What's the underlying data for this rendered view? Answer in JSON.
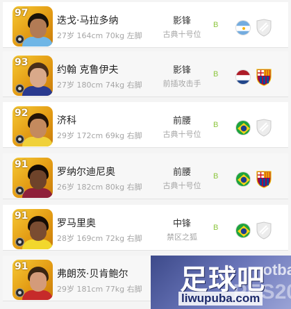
{
  "players": [
    {
      "rating": "97",
      "name": "迭戈·马拉多纳",
      "meta": "27岁 164cm 70kg 左脚",
      "position": "影锋",
      "role": "古典十号位",
      "grade": "B",
      "nation": "argentina-flag-icon",
      "club": "generic-club-shield-icon",
      "colors": {
        "hair": "#1a1209",
        "skin": "#b27b55",
        "shirt": "#6fb6e6"
      }
    },
    {
      "rating": "93",
      "name": "约翰 克鲁伊夫",
      "meta": "27岁 180cm 74kg 右脚",
      "position": "影锋",
      "role": "前插攻击手",
      "grade": "B",
      "nation": "netherlands-flag-icon",
      "club": "barcelona-crest-icon",
      "colors": {
        "hair": "#4a2e19",
        "skin": "#d9a98a",
        "shirt": "#2a3a8f"
      }
    },
    {
      "rating": "92",
      "name": "济科",
      "meta": "29岁 172cm 69kg 右脚",
      "position": "前腰",
      "role": "古典十号位",
      "grade": "B",
      "nation": "brazil-flag-icon",
      "club": "generic-club-shield-icon",
      "colors": {
        "hair": "#241407",
        "skin": "#c48a5e",
        "shirt": "#f0d13a"
      }
    },
    {
      "rating": "91",
      "name": "罗纳尔迪尼奥",
      "meta": "26岁 182cm 80kg 右脚",
      "position": "前腰",
      "role": "古典十号位",
      "grade": "B",
      "nation": "brazil-flag-icon",
      "club": "barcelona-crest-icon",
      "colors": {
        "hair": "#120a05",
        "skin": "#6e432a",
        "shirt": "#8f1f3a"
      }
    },
    {
      "rating": "91",
      "name": "罗马里奥",
      "meta": "28岁 169cm 72kg 右脚",
      "position": "中锋",
      "role": "禁区之狐",
      "grade": "B",
      "nation": "brazil-flag-icon",
      "club": "generic-club-shield-icon",
      "colors": {
        "hair": "#150c06",
        "skin": "#7a4c31",
        "shirt": "#f2d72c"
      }
    },
    {
      "rating": "91",
      "name": "弗朗茨·贝肯鲍尔",
      "meta": "29岁 181cm 77kg 右脚",
      "position": "",
      "role": "",
      "grade": "",
      "nation": "",
      "club": "",
      "colors": {
        "hair": "#3a2512",
        "skin": "#d49b7a",
        "shirt": "#c62a2a"
      }
    }
  ],
  "watermark": {
    "title": "足球吧",
    "url": "liwupuba.com",
    "en_text": "otba",
    "pes_text": "PES20"
  }
}
